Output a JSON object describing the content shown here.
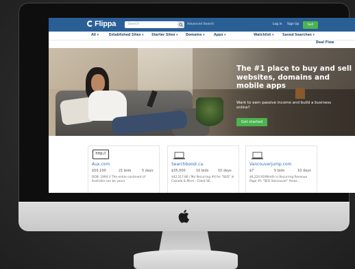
{
  "topnav": {
    "logo": "Flippa",
    "search_placeholder": "Search",
    "advanced_search": "Advanced Search",
    "login": "Log in",
    "signup": "Sign Up",
    "sell": "Sell"
  },
  "subnav": {
    "items": [
      "All ▾",
      "Established Sites ▾",
      "Starter Sites ▾",
      "Domains ▾",
      "Apps ▾",
      "Watchlist ▾",
      "Saved Searches ▾"
    ],
    "deal_flow": "Deal Flow"
  },
  "hero": {
    "title": "The #1 place to buy and sell websites, domains and mobile apps",
    "subtitle": "Want to earn passive income and build a business online?",
    "cta": "Get started"
  },
  "listings": [
    {
      "thumb": "http://",
      "title": "Aux.com",
      "price": "$50,100",
      "bids": "21 bids",
      "days": "5 days",
      "desc": "DOB: 1994 // The entire continent of Australia can be yours."
    },
    {
      "thumb": "laptop-icon",
      "title": "Searchboost.ca",
      "price": "$35,000",
      "bids": "10 bids",
      "days": "10 days",
      "desc": "$42,217.86 / Mo Recurring #4 for \"SEO\" in Canada & More - Client SE..."
    },
    {
      "thumb": "laptop-icon",
      "title": "Vancouverjump.com",
      "price": "$7",
      "bids": "5 bids",
      "days": "10 days",
      "desc": "$6,224.92/Month in Recurring Revenue Page #1 \"SEO Vancouver\" Amaz..."
    }
  ],
  "colors": {
    "nav": "#2a5f95",
    "accent_green": "#4cb34f",
    "link_blue": "#2a6fb8"
  }
}
